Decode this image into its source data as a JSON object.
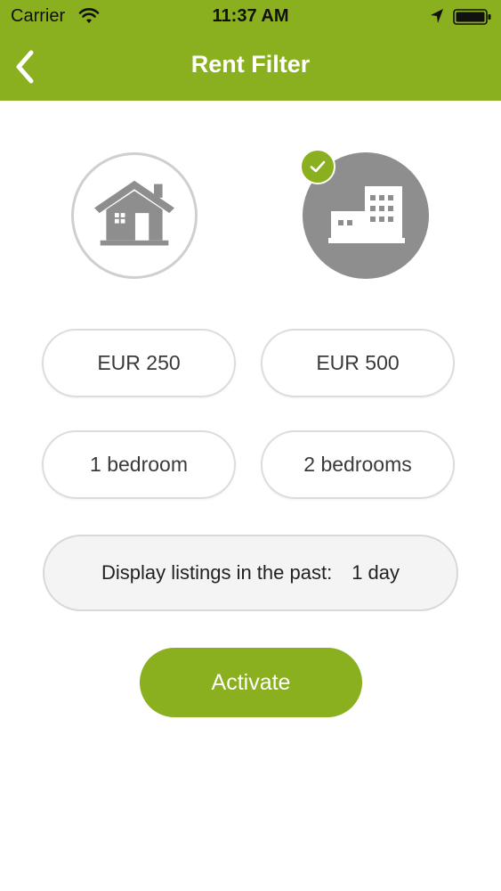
{
  "status_bar": {
    "carrier": "Carrier",
    "time": "11:37 AM"
  },
  "nav": {
    "title": "Rent Filter",
    "back_icon": "chevron-left-icon"
  },
  "property_types": [
    {
      "icon": "house-icon",
      "selected": false
    },
    {
      "icon": "apartment-building-icon",
      "selected": true
    }
  ],
  "price_options": [
    "EUR 250",
    "EUR 500"
  ],
  "bedroom_options": [
    "1 bedroom",
    "2 bedrooms"
  ],
  "listing_period": {
    "label": "Display listings in the past:",
    "value": "1 day"
  },
  "activate_label": "Activate",
  "colors": {
    "accent": "#8aaf1f",
    "icon_gray": "#8e8e8e",
    "border_gray": "#d8d8d8"
  }
}
